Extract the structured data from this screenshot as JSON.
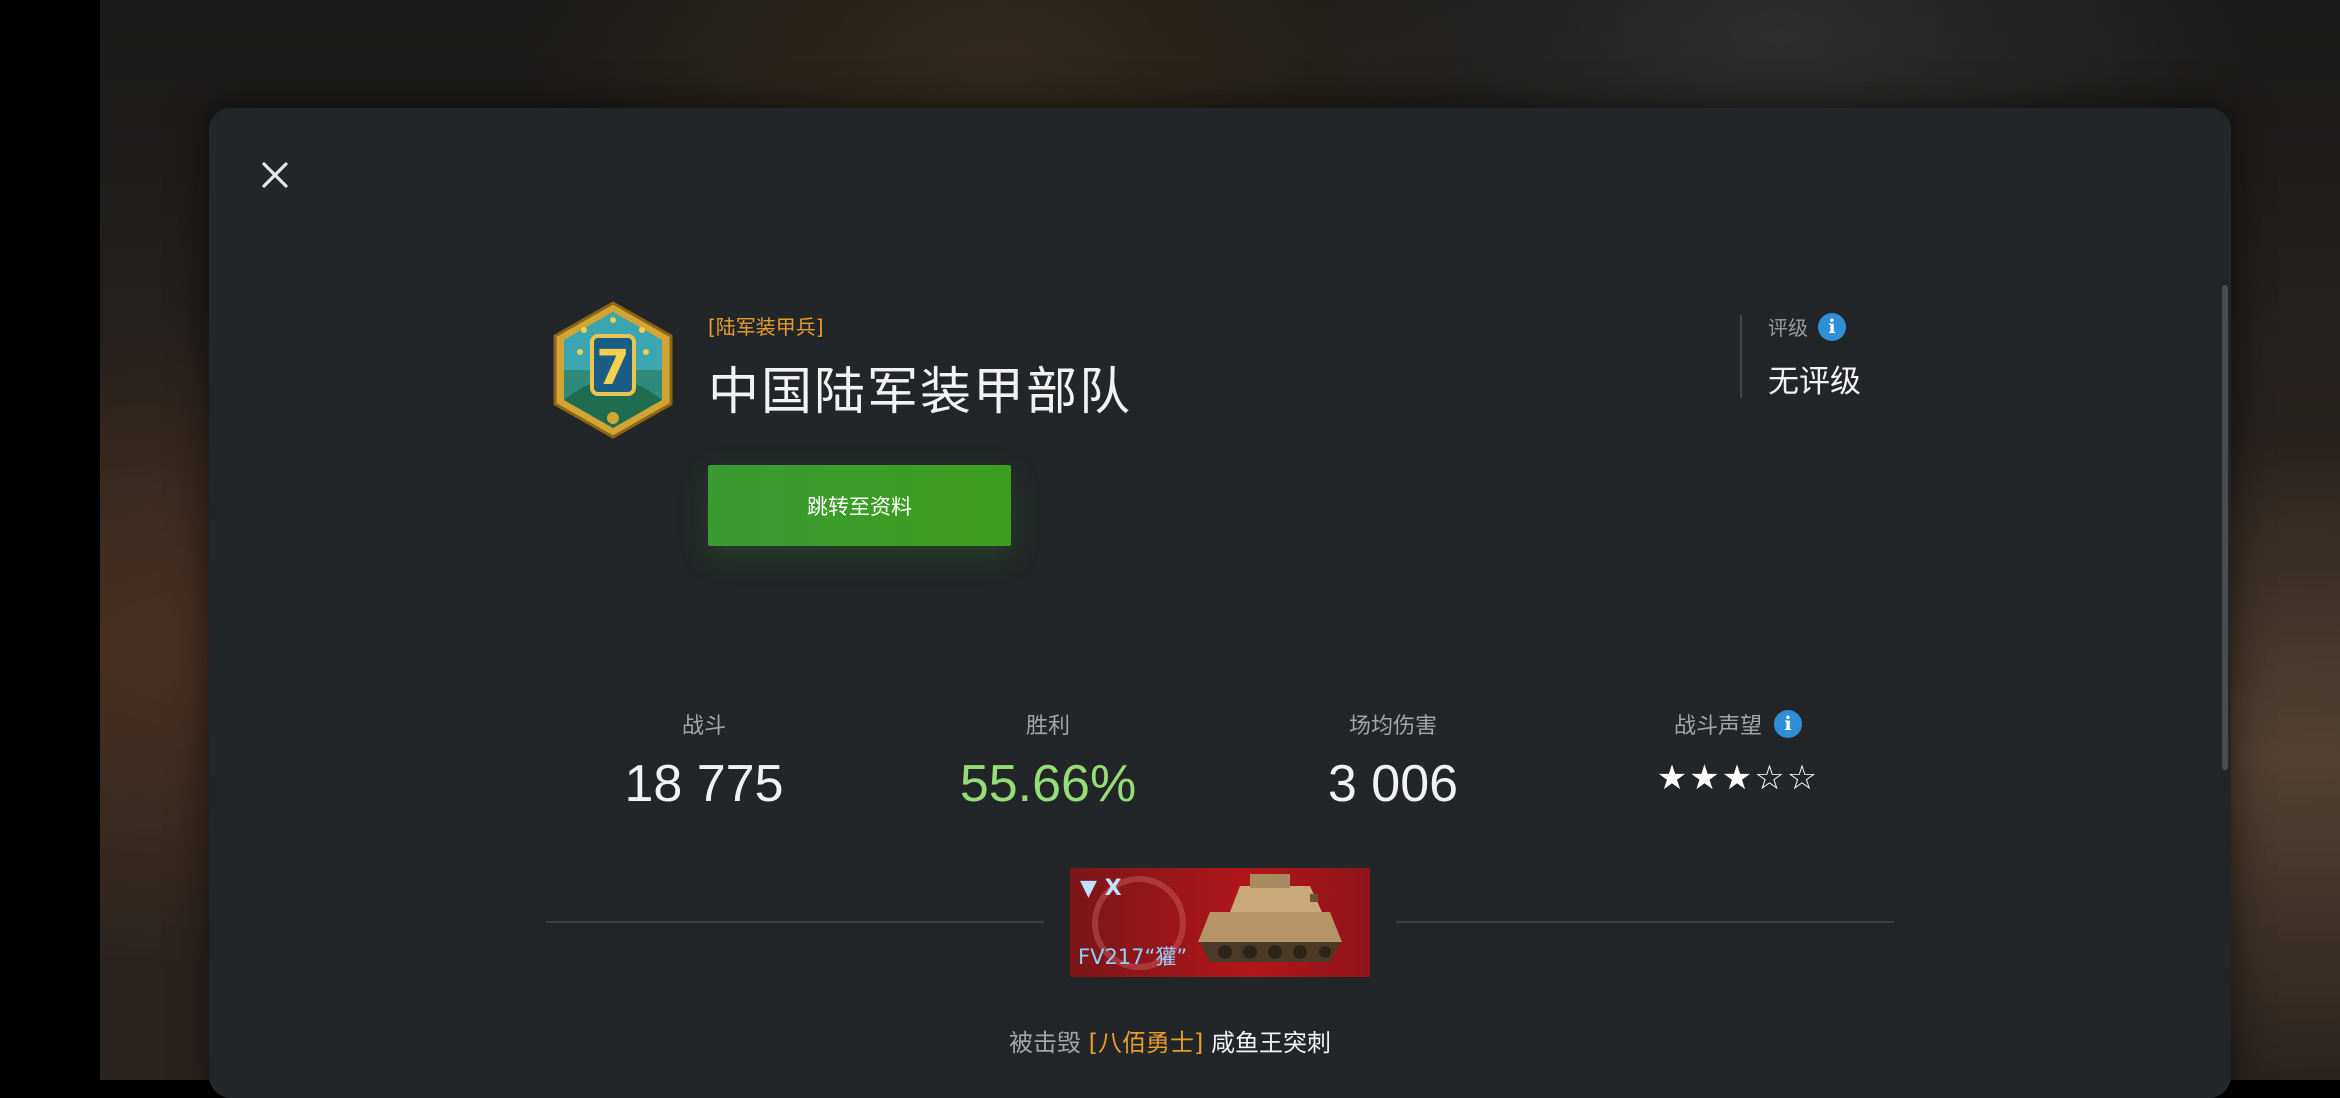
{
  "clan": {
    "tag": "[陆军装甲兵]",
    "name": "中国陆军装甲部队",
    "emblem_number": "7"
  },
  "profile_button": "跳转至资料",
  "rating": {
    "label": "评级",
    "value": "无评级"
  },
  "stats": {
    "battles": {
      "label": "战斗",
      "value": "18 775"
    },
    "wins": {
      "label": "胜利",
      "value": "55.66%"
    },
    "avg_damage": {
      "label": "场均伤害",
      "value": "3 006"
    },
    "prestige": {
      "label": "战斗声望",
      "stars": "★★★☆☆"
    }
  },
  "tank": {
    "tier": "X",
    "name": "FV217“獾”"
  },
  "killed_by": {
    "prefix": "被击毁",
    "tag": "[八佰勇士]",
    "player": "咸鱼王突刺"
  },
  "colors": {
    "accent_orange": "#e89c2c",
    "win_green": "#97dd77",
    "button_green": "#3c9e1d",
    "info_blue": "#2f8fd8"
  }
}
